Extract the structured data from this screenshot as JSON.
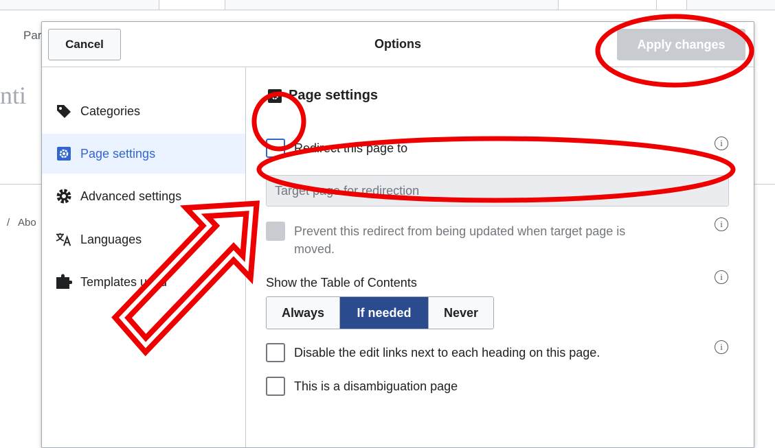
{
  "background": {
    "tab_fragment": "Par",
    "title_fragment": "nti",
    "footer_fragment": "Abo",
    "footer_separator": "/"
  },
  "dialog": {
    "title": "Options",
    "cancel_label": "Cancel",
    "apply_label": "Apply changes"
  },
  "sidebar": {
    "items": [
      {
        "label": "Categories",
        "icon": "tag-icon",
        "active": false
      },
      {
        "label": "Page settings",
        "icon": "settings-icon",
        "active": true
      },
      {
        "label": "Advanced settings",
        "icon": "gear-icon",
        "active": false
      },
      {
        "label": "Languages",
        "icon": "language-icon",
        "active": false
      },
      {
        "label": "Templates used",
        "icon": "puzzle-icon",
        "active": false
      }
    ]
  },
  "page_settings": {
    "heading": "Page settings",
    "redirect_label": "Redirect this page to",
    "redirect_checked": false,
    "target_placeholder": "Target page for redirection",
    "prevent_label_line1": "Prevent this redirect from being updated when target page is",
    "prevent_label_line2": "moved.",
    "prevent_disabled": true,
    "toc_label": "Show the Table of Contents",
    "toc_options": [
      "Always",
      "If needed",
      "Never"
    ],
    "toc_selected": "If needed",
    "disable_edit_links_label": "Disable the edit links next to each heading on this page.",
    "disambiguation_label": "This is a disambiguation page",
    "info_glyph": "i"
  },
  "colors": {
    "accent": "#3366cc",
    "selected_segment": "#2a4b8d",
    "annotation": "#ee0000",
    "disabled": "#c8ccd1"
  }
}
